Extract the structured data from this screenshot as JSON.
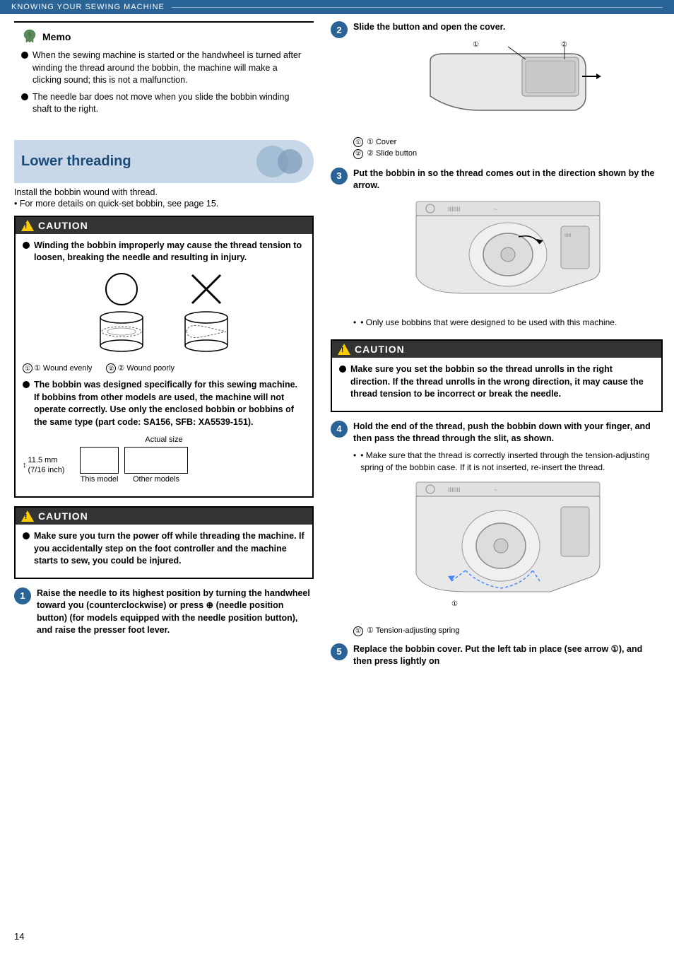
{
  "header": {
    "text": "KNOWING YOUR SEWING MACHINE"
  },
  "memo": {
    "title": "Memo",
    "items": [
      "When the sewing machine is started or the handwheel is turned after winding the thread around the bobbin, the machine will make a clicking sound; this is not a malfunction.",
      "The needle bar does not move when you slide the bobbin winding shaft to the right."
    ]
  },
  "lower_threading": {
    "title": "Lower threading",
    "install_text": "Install the bobbin wound with thread.",
    "install_sub": "• For more details on quick-set bobbin, see page 15."
  },
  "caution1": {
    "label": "CAUTION",
    "items": [
      "Winding the bobbin improperly may cause the thread tension to loosen, breaking the needle and resulting in injury.",
      "The bobbin was designed specifically for this sewing machine. If bobbins from other models are used, the machine will not operate correctly. Use only the enclosed bobbin or bobbins of the same type (part code: SA156, SFB: XA5539-151)."
    ],
    "wound_evenly": "① Wound evenly",
    "wound_poorly": "② Wound poorly",
    "actual_size": "Actual size",
    "size_label": "11.5 mm\n(7/16 inch)",
    "this_model": "This model",
    "other_models": "Other models"
  },
  "caution2": {
    "label": "CAUTION",
    "items": [
      "Make sure you turn the power off while threading the machine. If you accidentally step on the foot controller and the machine starts to sew, you could be injured."
    ]
  },
  "step1": {
    "num": "1",
    "text": "Raise the needle to its highest position by turning the handwheel toward you (counterclockwise) or press ⊕ (needle position button) (for models equipped with the needle position button), and raise the presser foot lever."
  },
  "step2": {
    "num": "2",
    "title": "Slide the button and open the cover.",
    "cover_label": "① Cover",
    "slide_button_label": "② Slide button"
  },
  "step3": {
    "num": "3",
    "title": "Put the bobbin in so the thread comes out in the direction shown by the arrow.",
    "sub": "• Only use bobbins that were designed to be used with this machine."
  },
  "caution3": {
    "label": "CAUTION",
    "items": [
      "Make sure you set the bobbin so the thread unrolls in the right direction. If the thread unrolls in the wrong direction, it may cause the thread tension to be incorrect or break the needle."
    ]
  },
  "step4": {
    "num": "4",
    "title": "Hold the end of the thread, push the bobbin down with your finger, and then pass the thread through the slit, as shown.",
    "sub": "• Make sure that the thread is correctly inserted through the tension-adjusting spring of the bobbin case. If it is not inserted, re-insert the thread.",
    "tension_label": "① Tension-adjusting spring"
  },
  "step5": {
    "num": "5",
    "title": "Replace the bobbin cover. Put the left tab in place (see arrow ①), and then press lightly on"
  },
  "page_number": "14"
}
